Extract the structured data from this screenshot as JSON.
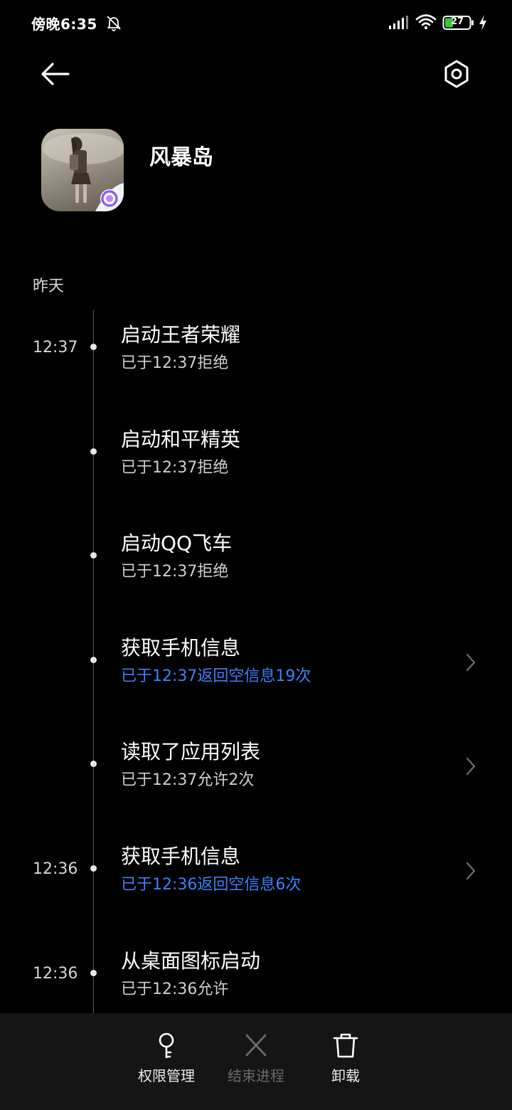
{
  "status_bar": {
    "time": "傍晚6:35",
    "battery": "27",
    "icons": [
      "mute-bell-icon",
      "signal-icon",
      "wifi-icon",
      "battery-icon",
      "charging-icon"
    ]
  },
  "header": {
    "back_icon": "arrow-left-icon",
    "settings_icon": "hexagon-gear-icon"
  },
  "app": {
    "name": "风暴岛"
  },
  "section": {
    "label": "昨天"
  },
  "colors": {
    "background": "#000000",
    "accent_blue": "#3b82f6",
    "bottom_bar": "#151515",
    "disabled": "#6a6a6a"
  },
  "entries": [
    {
      "time": "12:37",
      "title": "启动王者荣耀",
      "subtitle": "已于12:37拒绝",
      "highlight": false,
      "chevron": false
    },
    {
      "time": "",
      "title": "启动和平精英",
      "subtitle": "已于12:37拒绝",
      "highlight": false,
      "chevron": false
    },
    {
      "time": "",
      "title": "启动QQ飞车",
      "subtitle": "已于12:37拒绝",
      "highlight": false,
      "chevron": false
    },
    {
      "time": "",
      "title": "获取手机信息",
      "subtitle": "已于12:37返回空信息19次",
      "highlight": true,
      "chevron": true
    },
    {
      "time": "",
      "title": "读取了应用列表",
      "subtitle": "已于12:37允许2次",
      "highlight": false,
      "chevron": true
    },
    {
      "time": "12:36",
      "title": "获取手机信息",
      "subtitle": "已于12:36返回空信息6次",
      "highlight": true,
      "chevron": true
    },
    {
      "time": "12:36",
      "title": "从桌面图标启动",
      "subtitle": "已于12:36允许",
      "highlight": false,
      "chevron": false
    }
  ],
  "bottom_bar": {
    "permissions_label": "权限管理",
    "end_process_label": "结束进程",
    "uninstall_label": "卸载"
  }
}
